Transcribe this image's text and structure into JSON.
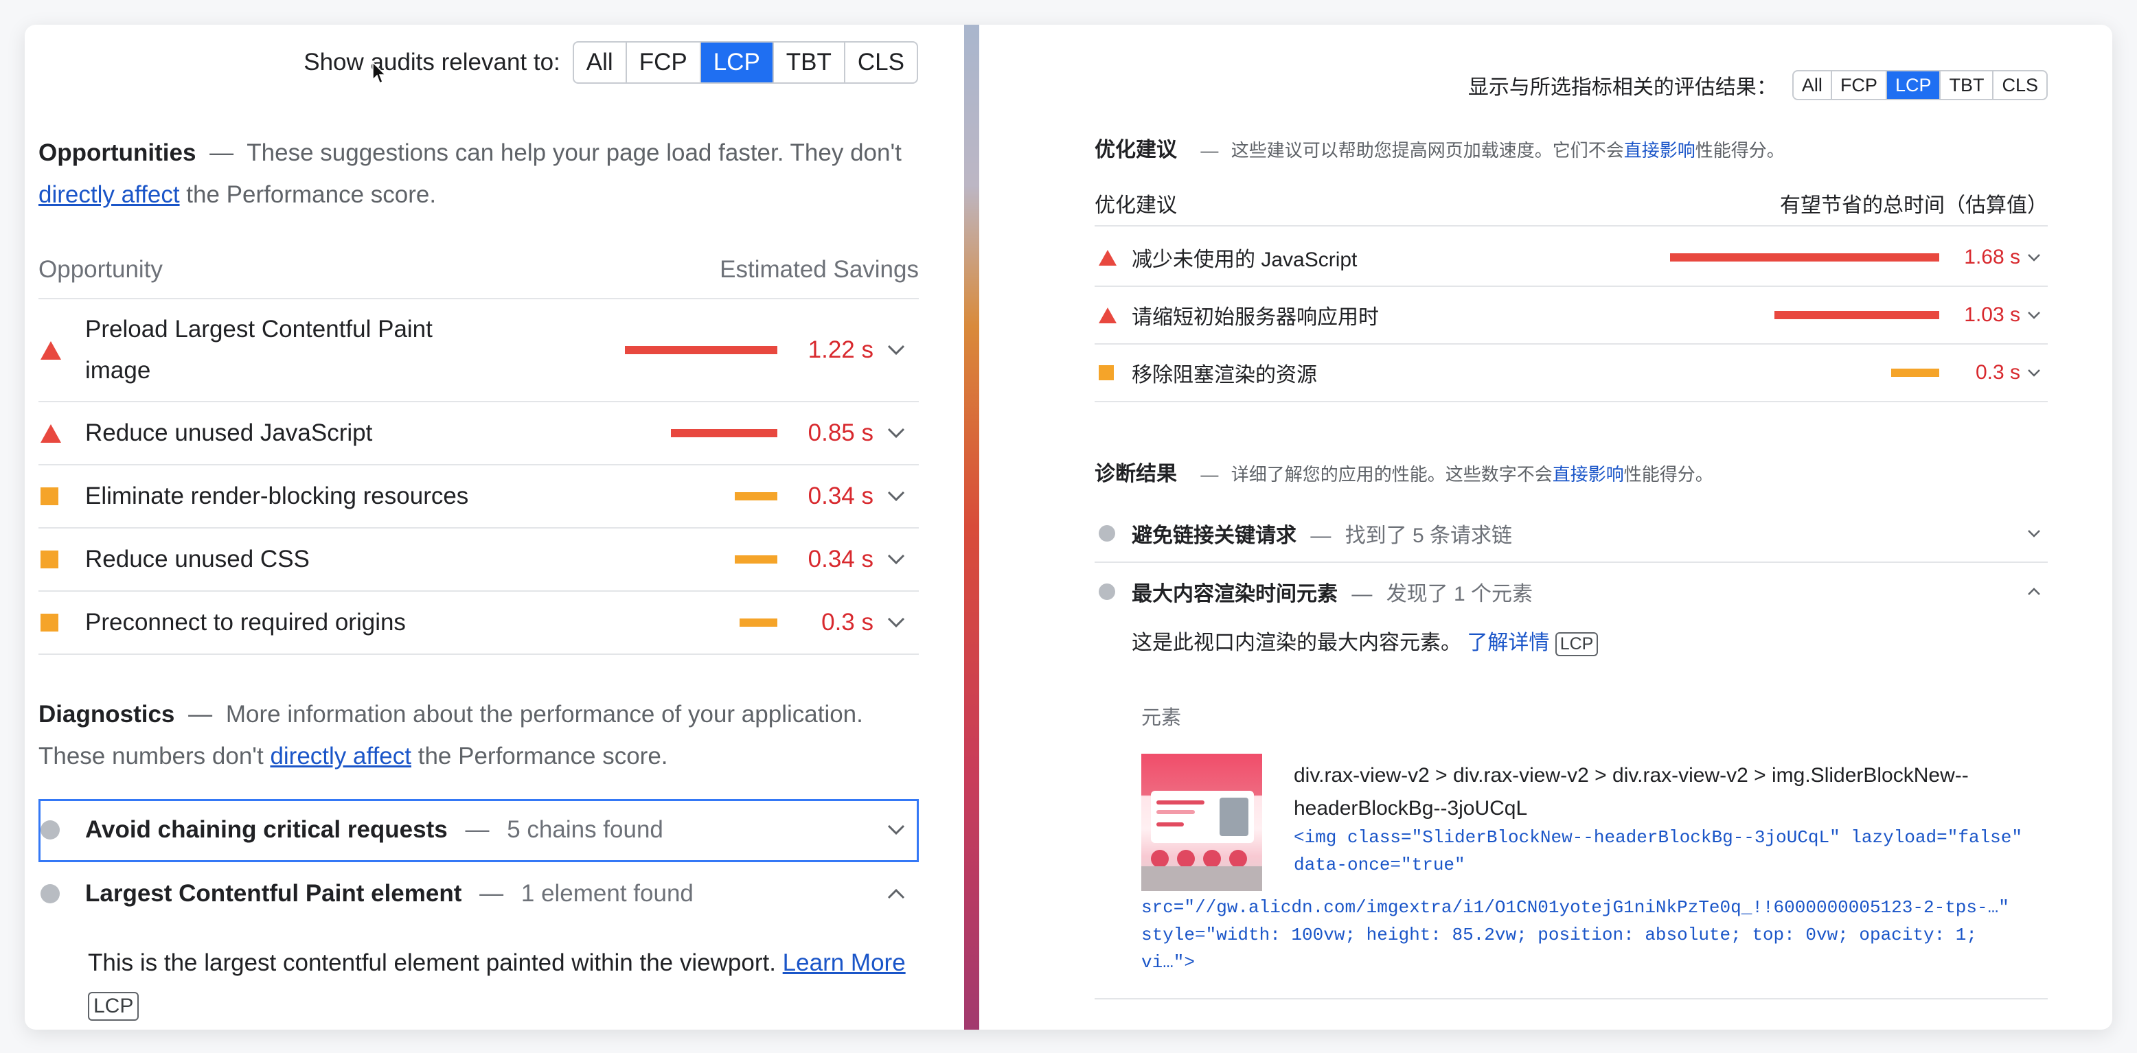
{
  "left": {
    "filter": {
      "label": "Show audits relevant to:",
      "options": [
        "All",
        "FCP",
        "LCP",
        "TBT",
        "CLS"
      ],
      "active": "LCP"
    },
    "opportunities": {
      "title": "Opportunities",
      "dash": "—",
      "desc_a": "These suggestions can help your page load faster. They don't",
      "link": "directly affect",
      "desc_b": "the Performance score.",
      "col_left": "Opportunity",
      "col_right": "Estimated Savings",
      "items": [
        {
          "title": "Preload Largest Contentful Paint image",
          "saving": "1.22 s",
          "severity": "fail",
          "value_s": 1.22
        },
        {
          "title": "Reduce unused JavaScript",
          "saving": "0.85 s",
          "severity": "fail",
          "value_s": 0.85
        },
        {
          "title": "Eliminate render-blocking resources",
          "saving": "0.34 s",
          "severity": "average",
          "value_s": 0.34
        },
        {
          "title": "Reduce unused CSS",
          "saving": "0.34 s",
          "severity": "average",
          "value_s": 0.34
        },
        {
          "title": "Preconnect to required origins",
          "saving": "0.3 s",
          "severity": "average",
          "value_s": 0.3
        }
      ]
    },
    "diagnostics": {
      "title": "Diagnostics",
      "dash": "—",
      "desc_a": "More information about the performance of your application. These numbers don't",
      "link": "directly affect",
      "desc_b": "the Performance score.",
      "items": [
        {
          "title": "Avoid chaining critical requests",
          "dash": "—",
          "sub": "5 chains found",
          "expanded": false
        },
        {
          "title": "Largest Contentful Paint element",
          "dash": "—",
          "sub": "1 element found",
          "expanded": true
        }
      ],
      "detail_text": "This is the largest contentful element painted within the viewport.",
      "learn_more": "Learn More",
      "badge": "LCP"
    }
  },
  "right": {
    "filter": {
      "label": "显示与所选指标相关的评估结果：",
      "options": [
        "All",
        "FCP",
        "LCP",
        "TBT",
        "CLS"
      ],
      "active": "LCP"
    },
    "opportunities": {
      "title": "优化建议",
      "dash": "—",
      "desc_a": "这些建议可以帮助您提高网页加载速度。它们不会",
      "link": "直接影响",
      "desc_b": "性能得分。",
      "col_left": "优化建议",
      "col_right": "有望节省的总时间（估算值）",
      "items": [
        {
          "title": "减少未使用的 JavaScript",
          "saving": "1.68 s",
          "severity": "fail",
          "value_s": 1.68
        },
        {
          "title": "请缩短初始服务器响应用时",
          "saving": "1.03 s",
          "severity": "fail",
          "value_s": 1.03
        },
        {
          "title": "移除阻塞渲染的资源",
          "saving": "0.3 s",
          "severity": "average",
          "value_s": 0.3
        }
      ]
    },
    "diagnostics": {
      "title": "诊断结果",
      "dash": "—",
      "desc_a": "详细了解您的应用的性能。这些数字不会",
      "link": "直接影响",
      "desc_b": "性能得分。",
      "items": [
        {
          "title": "避免链接关键请求",
          "dash": "—",
          "sub": "找到了 5 条请求链",
          "expanded": false
        },
        {
          "title": "最大内容渲染时间元素",
          "dash": "—",
          "sub": "发现了 1 个元素",
          "expanded": true
        }
      ],
      "detail_text": "这是此视口内渲染的最大内容元素。",
      "learn_more": "了解详情",
      "badge": "LCP",
      "element_col": "元素",
      "element_selector": "div.rax-view-v2 > div.rax-view-v2 > div.rax-view-v2 > img.SliderBlockNew--headerBlockBg--3joUCqL",
      "code_line1": "<img class=\"SliderBlockNew--headerBlockBg--3joUCqL\" lazyload=\"false\"",
      "code_line2": "data-once=\"true\"",
      "code_line3": "src=\"//gw.alicdn.com/imgextra/i1/O1CN01yotejG1niNkPzTe0q_!!6000000005123-2-tps-…\"",
      "code_line4": "style=\"width: 100vw; height: 85.2vw; position: absolute; top: 0vw; opacity: 1;",
      "code_line5": "vi…\">"
    }
  },
  "colors": {
    "fail": "#e8483f",
    "average": "#f5a429",
    "active_filter": "#1f6ff2",
    "link": "#1a55c8"
  }
}
